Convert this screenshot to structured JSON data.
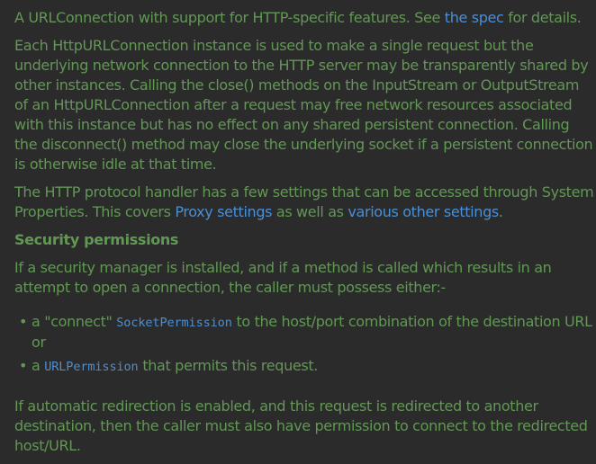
{
  "doc": {
    "intro": {
      "before": "A URLConnection with support for HTTP-specific features. See ",
      "link": "the spec",
      "after": " for details."
    },
    "para1": "Each HttpURLConnection instance is used to make a single request but the underlying network connection to the HTTP server may be transparently shared by other instances. Calling the close() methods on the InputStream or OutputStream of an HttpURLConnection after a request may free network resources associated with this instance but has no effect on any shared persistent connection. Calling the disconnect() method may close the underlying socket if a persistent connection is otherwise idle at that time.",
    "para2": {
      "before": "The HTTP protocol handler has a few settings that can be accessed through System Properties. This covers ",
      "link1": "Proxy settings",
      "middle": " as well as ",
      "link2": "various other settings",
      "after": "."
    },
    "security_heading": "Security permissions",
    "para3": "If a security manager is installed, and if a method is called which results in an attempt to open a connection, the caller must possess either:-",
    "bullets": [
      {
        "dot": "•",
        "before": "a \"connect\" ",
        "code": "SocketPermission",
        "after": " to the host/port combination of the destination URL or"
      },
      {
        "dot": "•",
        "before": "a ",
        "code": "URLPermission",
        "after": " that permits this request."
      }
    ],
    "para4": "If automatic redirection is enabled, and this request is redirected to another destination, then the caller must also have permission to connect to the redirected host/URL."
  },
  "colors": {
    "background": "#2b2b2b",
    "text": "#629755",
    "link": "#4a8fd6"
  }
}
